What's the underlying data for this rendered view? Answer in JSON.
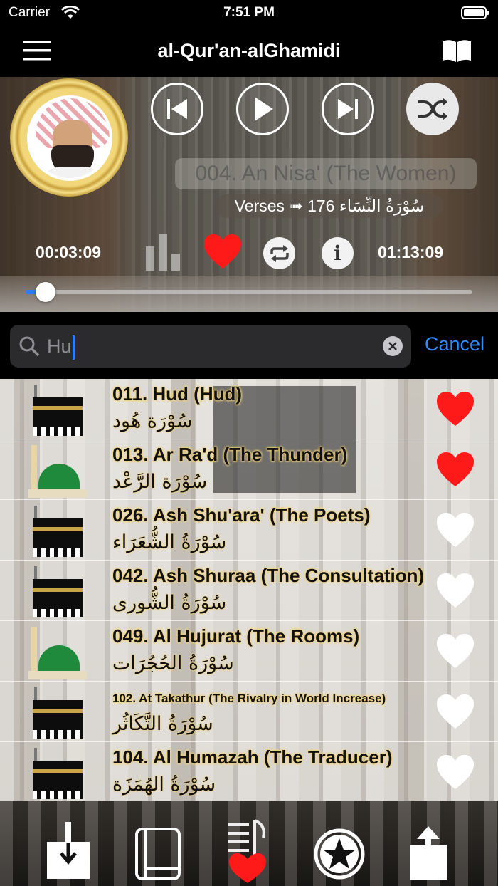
{
  "status_bar": {
    "carrier": "Carrier",
    "time": "7:51 PM"
  },
  "nav": {
    "title": "al-Qur'an-alGhamidi",
    "menu_icon": "hamburger-menu-icon",
    "right_icon": "open-book-icon"
  },
  "player": {
    "track_title": "004. An Nisa' (The Women)",
    "verses_text": "Verses ➟ 176 سُوْرَةُ النِّسَاء",
    "elapsed": "00:03:09",
    "duration": "01:13:09",
    "progress": 0.045,
    "favorite": true,
    "info_label": "i"
  },
  "search": {
    "value": "Hu",
    "placeholder": "Search",
    "cancel_label": "Cancel"
  },
  "list": [
    {
      "title": "011. Hud (Hud)",
      "arabic": "سُوْرَة هُود",
      "thumb": "kaaba",
      "favorite": true
    },
    {
      "title": "013. Ar Ra'd (The Thunder)",
      "arabic": "سُوْرَة الرَّعْد",
      "thumb": "green-dome",
      "favorite": true
    },
    {
      "title": "026. Ash Shu'ara' (The Poets)",
      "arabic": "سُوْرَةُ الشُّعَرَاء",
      "thumb": "kaaba",
      "favorite": false
    },
    {
      "title": "042. Ash Shuraa (The Consultation)",
      "arabic": "سُوْرَةُ الشُّورى",
      "thumb": "kaaba",
      "favorite": false
    },
    {
      "title": "049. Al Hujurat (The Rooms)",
      "arabic": "سُوْرَةُ الحُجُرَات",
      "thumb": "green-dome",
      "favorite": false
    },
    {
      "title": "102. At Takathur (The Rivalry in World Increase)",
      "arabic": "سُوْرَةُ التَّكَاثُر",
      "thumb": "kaaba",
      "favorite": false
    },
    {
      "title": "104. Al Humazah (The Traducer)",
      "arabic": "سُوْرَةُ الهُمَزَة",
      "thumb": "kaaba",
      "favorite": false
    }
  ],
  "tab_bar": {
    "items": [
      "download-icon",
      "book-icon",
      "favorites-playlist-icon",
      "star-circle-icon",
      "share-icon"
    ]
  },
  "colors": {
    "accent_blue": "#2f8cff",
    "heart_red": "#ff1a1a",
    "title_glow": "#f3d27a"
  }
}
